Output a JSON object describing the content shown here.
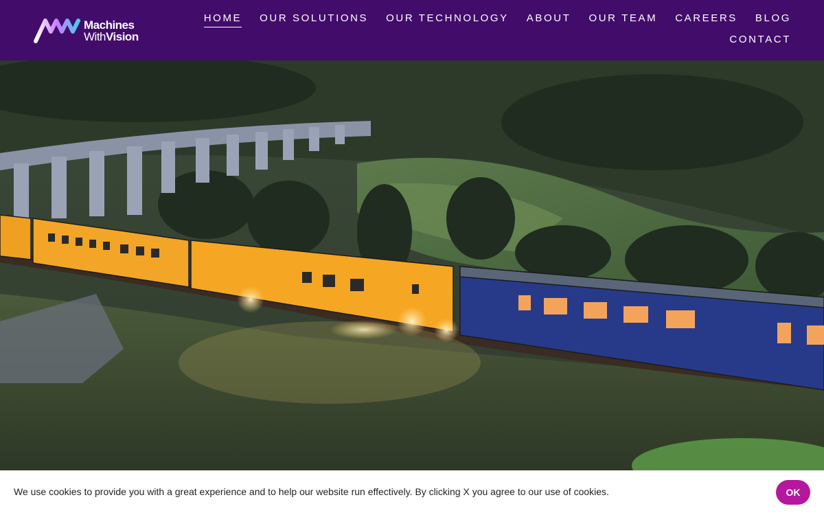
{
  "brand": {
    "name_line1": "Machines",
    "name_line2_a": "With",
    "name_line2_b": "Vision",
    "logo_icon": "mv-logo-icon",
    "header_bg": "#420c6b",
    "accent": "#b5179e"
  },
  "nav": {
    "row1": [
      "Home",
      "Our Solutions",
      "Our Technology",
      "About",
      "Our Team",
      "Careers",
      "Blog"
    ],
    "row2": [
      "Contact"
    ],
    "active": "Home"
  },
  "hero": {
    "image": "night train crossing stone viaduct in green valley"
  },
  "cookie": {
    "message": "We use cookies to provide you with a great experience and to help our website run effectively. By clicking X you agree to our use of cookies.",
    "ok_label": "OK"
  }
}
